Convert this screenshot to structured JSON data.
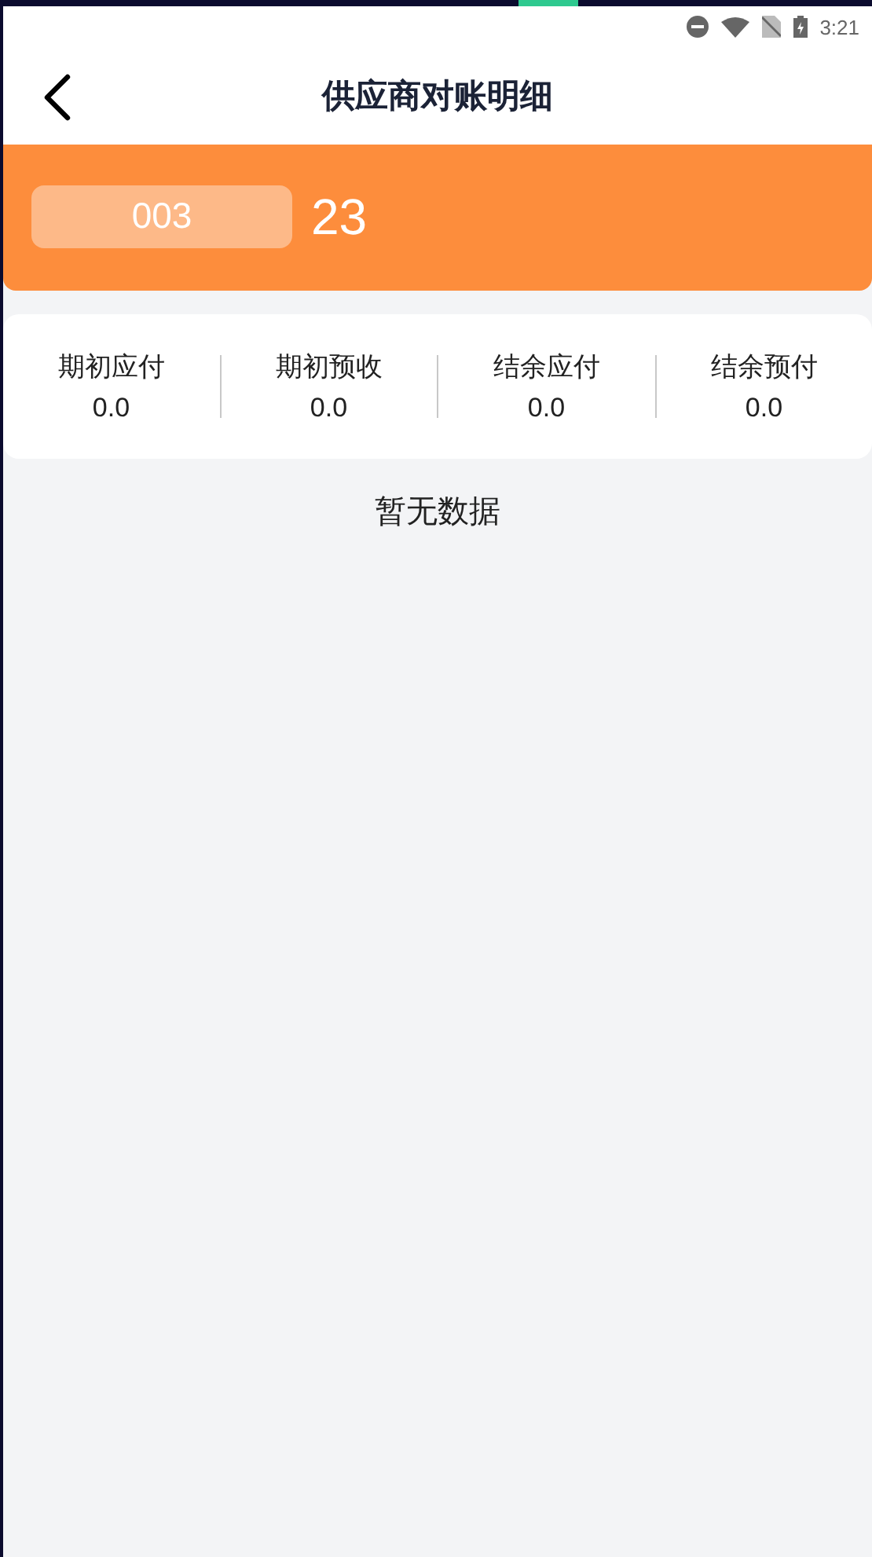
{
  "status_bar": {
    "time": "3:21"
  },
  "header": {
    "title": "供应商对账明细"
  },
  "supplier": {
    "code": "003",
    "name": "23"
  },
  "summary": [
    {
      "label": "期初应付",
      "value": "0.0"
    },
    {
      "label": "期初预收",
      "value": "0.0"
    },
    {
      "label": "结余应付",
      "value": "0.0"
    },
    {
      "label": "结余预付",
      "value": "0.0"
    }
  ],
  "empty_message": "暂无数据"
}
